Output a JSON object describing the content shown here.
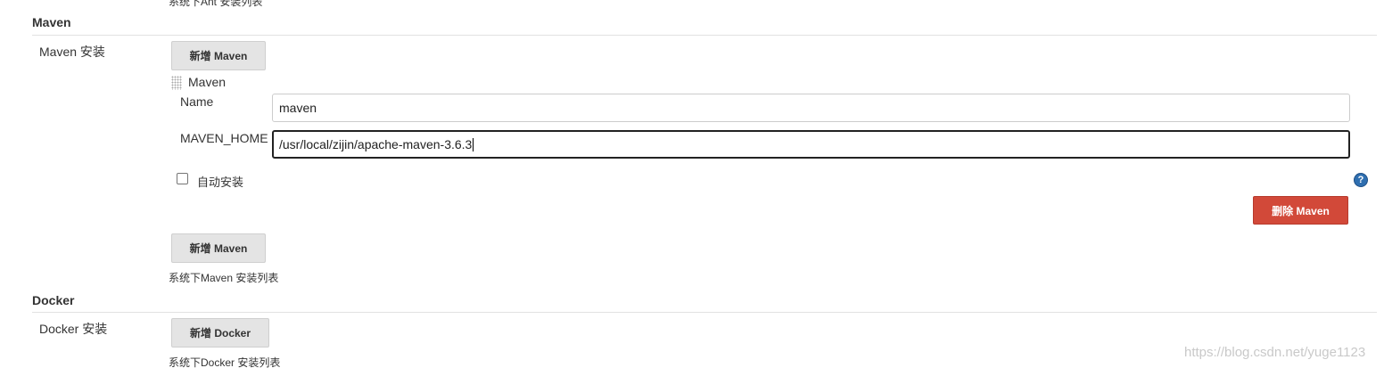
{
  "ant": {
    "description_cut": "系统下Ant 安装列表"
  },
  "maven": {
    "section_title": "Maven",
    "install_label": "Maven 安装",
    "add_button_label": "新增 Maven",
    "installation": {
      "title": "Maven",
      "name_label": "Name",
      "name_value": "maven",
      "home_label": "MAVEN_HOME",
      "home_value": "/usr/local/zijin/apache-maven-3.6.3",
      "auto_install_label": "自动安装",
      "auto_install_checked": false,
      "help_glyph": "?",
      "delete_button_label": "删除 Maven"
    },
    "description": "系统下Maven 安装列表"
  },
  "docker": {
    "section_title": "Docker",
    "install_label": "Docker 安装",
    "add_button_label": "新增 Docker",
    "description": "系统下Docker 安装列表"
  },
  "watermark": "https://blog.csdn.net/yuge1123",
  "colors": {
    "delete_button": "#d24939",
    "button_gray": "#e4e4e4",
    "help_icon": "#2f6fb0",
    "section_rule": "#e2e2e2"
  },
  "icons": {
    "drag_handle": "drag-handle-icon",
    "help": "help-icon"
  }
}
